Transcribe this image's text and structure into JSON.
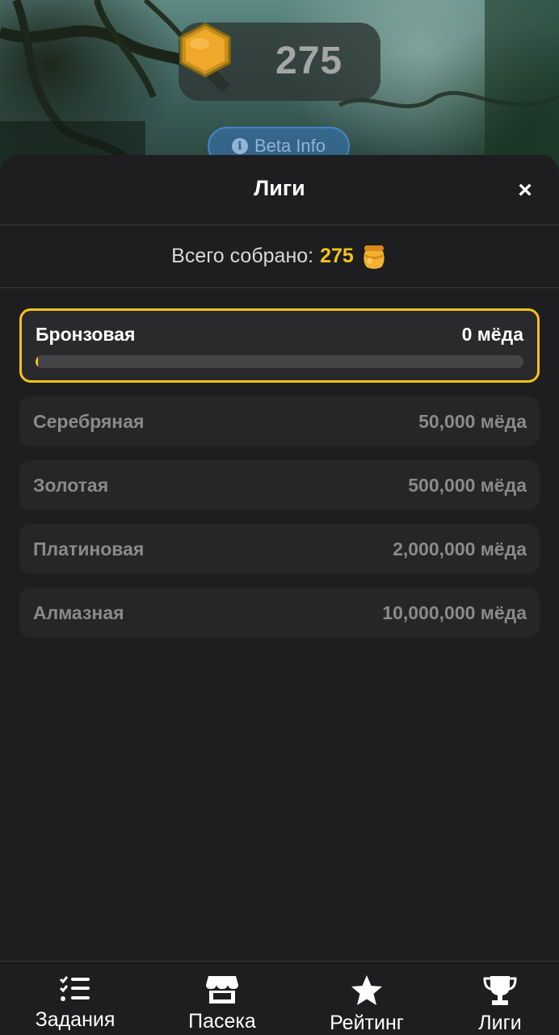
{
  "header": {
    "balance": "275",
    "beta_button": "Beta Info"
  },
  "sheet": {
    "title": "Лиги",
    "close": "×",
    "total_label": "Всего собрано:",
    "total_value": "275"
  },
  "leagues": [
    {
      "name": "Бронзовая",
      "requirement": "0 мёда",
      "active": true,
      "progress": 0.0
    },
    {
      "name": "Серебряная",
      "requirement": "50,000 мёда"
    },
    {
      "name": "Золотая",
      "requirement": "500,000 мёда"
    },
    {
      "name": "Платиновая",
      "requirement": "2,000,000 мёда"
    },
    {
      "name": "Алмазная",
      "requirement": "10,000,000 мёда"
    }
  ],
  "nav": [
    {
      "label": "Задания",
      "icon": "tasks-icon"
    },
    {
      "label": "Пасека",
      "icon": "store-icon"
    },
    {
      "label": "Рейтинг",
      "icon": "star-icon"
    },
    {
      "label": "Лиги",
      "icon": "trophy-icon"
    }
  ],
  "colors": {
    "accent": "#f5c21b",
    "background": "#1e1e20",
    "card": "#262628"
  }
}
